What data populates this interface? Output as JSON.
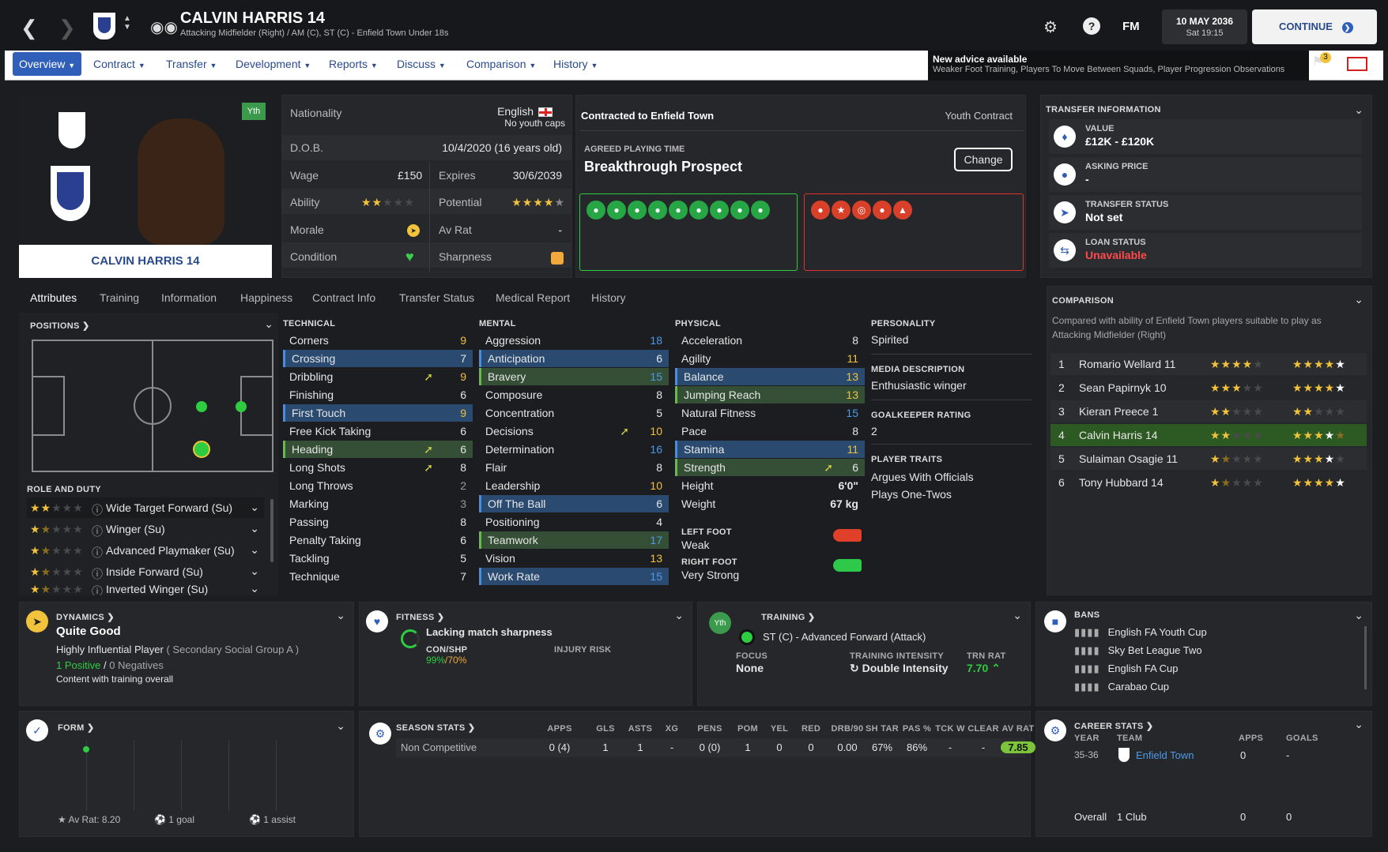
{
  "header": {
    "player_name": "CALVIN HARRIS 14",
    "subtitle": "Attacking Midfielder (Right) / AM (C), ST (C) - Enfield Town Under 18s",
    "date": "10 MAY 2036",
    "time": "Sat 19:15",
    "continue": "CONTINUE",
    "fm": "FM"
  },
  "nav": {
    "items": [
      "Overview",
      "Contract",
      "Transfer",
      "Development",
      "Reports",
      "Discuss",
      "Comparison",
      "History"
    ]
  },
  "advice": {
    "title": "New advice available",
    "text": "Weaker Foot Training, Players To Move Between Squads, Player Progression Observations",
    "badge": "3"
  },
  "profile": {
    "card_name": "CALVIN HARRIS 14",
    "yth": "Yth"
  },
  "info": {
    "nationality_label": "Nationality",
    "nationality": "English",
    "youth_caps": "No youth caps",
    "dob_label": "D.O.B.",
    "dob": "10/4/2020 (16 years old)",
    "wage_label": "Wage",
    "wage": "£150",
    "expires_label": "Expires",
    "expires": "30/6/2039",
    "ability_label": "Ability",
    "potential_label": "Potential",
    "morale_label": "Morale",
    "avrat_label": "Av Rat",
    "avrat": "-",
    "condition_label": "Condition",
    "sharpness_label": "Sharpness"
  },
  "contract": {
    "title": "Contracted to Enfield Town",
    "type": "Youth Contract",
    "apt_label": "AGREED PLAYING TIME",
    "apt": "Breakthrough Prospect",
    "change": "Change"
  },
  "transfer": {
    "title": "TRANSFER INFORMATION",
    "value_label": "VALUE",
    "value": "£12K - £120K",
    "asking_label": "ASKING PRICE",
    "asking": "-",
    "status_label": "TRANSFER STATUS",
    "status": "Not set",
    "loan_label": "LOAN STATUS",
    "loan": "Unavailable"
  },
  "tabs": [
    "Attributes",
    "Training",
    "Information",
    "Happiness",
    "Contract Info",
    "Transfer Status",
    "Medical Report",
    "History"
  ],
  "positions": {
    "title": "POSITIONS",
    "role_title": "ROLE AND DUTY",
    "roles": [
      "Wide Target Forward (Su)",
      "Winger (Su)",
      "Advanced Playmaker (Su)",
      "Inside Forward (Su)",
      "Inverted Winger (Su)"
    ],
    "role_stars": [
      2,
      1.5,
      1.5,
      1.5,
      1.5
    ]
  },
  "technical": {
    "title": "TECHNICAL",
    "rows": [
      [
        "Corners",
        "9"
      ],
      [
        "Crossing",
        "7"
      ],
      [
        "Dribbling",
        "9"
      ],
      [
        "Finishing",
        "6"
      ],
      [
        "First Touch",
        "9"
      ],
      [
        "Free Kick Taking",
        "6"
      ],
      [
        "Heading",
        "6"
      ],
      [
        "Long Shots",
        "8"
      ],
      [
        "Long Throws",
        "2"
      ],
      [
        "Marking",
        "3"
      ],
      [
        "Passing",
        "8"
      ],
      [
        "Penalty Taking",
        "6"
      ],
      [
        "Tackling",
        "5"
      ],
      [
        "Technique",
        "7"
      ]
    ]
  },
  "mental": {
    "title": "MENTAL",
    "rows": [
      [
        "Aggression",
        "18"
      ],
      [
        "Anticipation",
        "6"
      ],
      [
        "Bravery",
        "15"
      ],
      [
        "Composure",
        "8"
      ],
      [
        "Concentration",
        "5"
      ],
      [
        "Decisions",
        "10"
      ],
      [
        "Determination",
        "16"
      ],
      [
        "Flair",
        "8"
      ],
      [
        "Leadership",
        "10"
      ],
      [
        "Off The Ball",
        "6"
      ],
      [
        "Positioning",
        "4"
      ],
      [
        "Teamwork",
        "17"
      ],
      [
        "Vision",
        "13"
      ],
      [
        "Work Rate",
        "15"
      ]
    ]
  },
  "physical": {
    "title": "PHYSICAL",
    "rows": [
      [
        "Acceleration",
        "8"
      ],
      [
        "Agility",
        "11"
      ],
      [
        "Balance",
        "13"
      ],
      [
        "Jumping Reach",
        "13"
      ],
      [
        "Natural Fitness",
        "15"
      ],
      [
        "Pace",
        "8"
      ],
      [
        "Stamina",
        "11"
      ],
      [
        "Strength",
        "6"
      ],
      [
        "Height",
        "6'0\""
      ],
      [
        "Weight",
        "67 kg"
      ]
    ],
    "left_foot_label": "LEFT FOOT",
    "left_foot": "Weak",
    "right_foot_label": "RIGHT FOOT",
    "right_foot": "Very Strong"
  },
  "personality": {
    "title": "PERSONALITY",
    "value": "Spirited",
    "media_title": "MEDIA DESCRIPTION",
    "media": "Enthusiastic winger",
    "gk_title": "GOALKEEPER RATING",
    "gk": "2",
    "traits_title": "PLAYER TRAITS",
    "traits": [
      "Argues With Officials",
      "Plays One-Twos"
    ]
  },
  "comparison": {
    "title": "COMPARISON",
    "desc": "Compared with ability of Enfield Town players suitable to play as Attacking Midfielder (Right)",
    "rows": [
      [
        "1",
        "Romario Wellard 11",
        4,
        5
      ],
      [
        "2",
        "Sean Papirnyk 10",
        3,
        5
      ],
      [
        "3",
        "Kieran Preece 1",
        2,
        2
      ],
      [
        "4",
        "Calvin Harris 14",
        2,
        3.5
      ],
      [
        "5",
        "Sulaiman Osagie 11",
        1.5,
        4
      ],
      [
        "6",
        "Tony Hubbard 14",
        1.5,
        5
      ]
    ]
  },
  "dynamics": {
    "title": "DYNAMICS",
    "value": "Quite Good",
    "influence": "Highly Influential Player",
    "group": "( Secondary Social Group A )",
    "positives": "1 Positive",
    "sep": "/",
    "negatives": "0 Negatives",
    "content": "Content with training overall"
  },
  "fitness": {
    "title": "FITNESS",
    "status": "Lacking match sharpness",
    "con_label": "CON/SHP",
    "con": "99%",
    "shp": "/70%",
    "injury_label": "INJURY RISK"
  },
  "training": {
    "title": "TRAINING",
    "yth": "Yth",
    "position": "ST (C) - Advanced Forward (Attack)",
    "focus_label": "FOCUS",
    "focus": "None",
    "intensity_label": "TRAINING INTENSITY",
    "intensity": "Double Intensity",
    "trnrat_label": "TRN RAT",
    "trnrat": "7.70"
  },
  "bans": {
    "title": "BANS",
    "items": [
      "English FA Youth Cup",
      "Sky Bet League Two",
      "English FA Cup",
      "Carabao Cup"
    ]
  },
  "form": {
    "title": "FORM",
    "avrat": "Av Rat: 8.20",
    "goals": "1 goal",
    "assists": "1 assist"
  },
  "season": {
    "title": "SEASON STATS",
    "headers": [
      "APPS",
      "GLS",
      "ASTS",
      "XG",
      "PENS",
      "POM",
      "YEL",
      "RED",
      "DRB/90",
      "SH TAR",
      "PAS %",
      "TCK W",
      "CLEAR",
      "AV RAT"
    ],
    "row_label": "Non Competitive",
    "row": [
      "0 (4)",
      "1",
      "1",
      "-",
      "0 (0)",
      "1",
      "0",
      "0",
      "0.00",
      "67%",
      "86%",
      "-",
      "-",
      "7.85"
    ]
  },
  "career": {
    "title": "CAREER STATS",
    "year_label": "YEAR",
    "team_label": "TEAM",
    "apps_label": "APPS",
    "goals_label": "GOALS",
    "year": "35-36",
    "team": "Enfield Town",
    "apps": "0",
    "goals": "-",
    "overall": "Overall",
    "clubs": "1 Club",
    "total_apps": "0",
    "total_goals": "0"
  },
  "colors": {
    "accent": "#2f5fb8",
    "green": "#2ecc40",
    "red": "#e03030",
    "gold": "#f1c23b"
  }
}
